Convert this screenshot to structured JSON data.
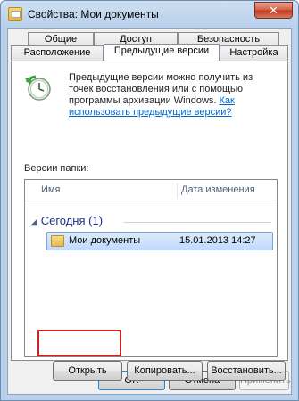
{
  "window": {
    "title": "Свойства: Мои документы",
    "close_glyph": "✕"
  },
  "tabs": {
    "row1": [
      "Общие",
      "Доступ",
      "Безопасность"
    ],
    "row2": [
      "Расположение",
      "Предыдущие версии",
      "Настройка"
    ],
    "active": "Предыдущие версии"
  },
  "panel": {
    "info_text": "Предыдущие версии можно получить из точек восстановления или с помощью программы архивации Windows.",
    "info_link": "Как использовать предыдущие версии?",
    "versions_label": "Версии папки:",
    "columns": [
      "Имя",
      "Дата изменения"
    ],
    "group": {
      "label": "Сегодня (1)",
      "chevron": "◢"
    },
    "rows": [
      {
        "name": "Мои документы",
        "date": "15.01.2013 14:27"
      }
    ],
    "buttons": {
      "open": "Открыть",
      "copy": "Копировать...",
      "restore": "Восстановить..."
    }
  },
  "dialog_buttons": {
    "ok": "OK",
    "cancel": "Отмена",
    "apply": "Применить"
  },
  "icons": {
    "window_icon": "folder-properties-icon",
    "clock_icon": "previous-versions-clock-icon",
    "folder_icon": "folder-icon"
  },
  "colors": {
    "highlight": "#d21f1f",
    "link": "#0066cc",
    "selection": "#c1dbfc"
  }
}
